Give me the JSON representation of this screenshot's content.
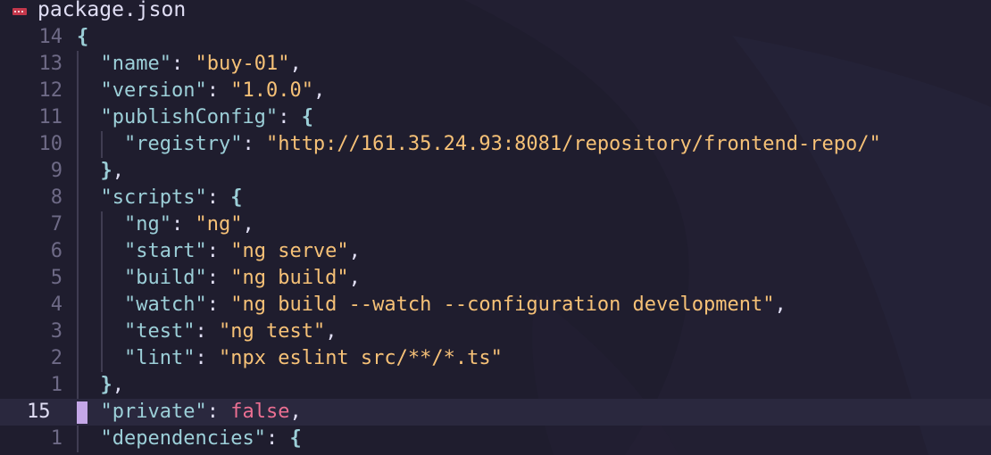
{
  "file": {
    "name": "package.json",
    "icon": "npm-file-icon"
  },
  "colors": {
    "background": "#1f1d2e",
    "key": "#9ccfd8",
    "string": "#f6c177",
    "keyword_false": "#eb6f92",
    "line_number": "#6e6a86",
    "current_line_bg": "#2a283e",
    "mode_marker": "#c4a7e7"
  },
  "lines": [
    {
      "num": "14",
      "indent": 0,
      "tokens": [
        {
          "t": "{",
          "c": "b"
        }
      ]
    },
    {
      "num": "13",
      "indent": 1,
      "tokens": [
        {
          "t": "\"name\"",
          "c": "k"
        },
        {
          "t": ": ",
          "c": "punct"
        },
        {
          "t": "\"buy-01\"",
          "c": "s"
        },
        {
          "t": ",",
          "c": "punct"
        }
      ]
    },
    {
      "num": "12",
      "indent": 1,
      "tokens": [
        {
          "t": "\"version\"",
          "c": "k"
        },
        {
          "t": ": ",
          "c": "punct"
        },
        {
          "t": "\"1.0.0\"",
          "c": "s"
        },
        {
          "t": ",",
          "c": "punct"
        }
      ]
    },
    {
      "num": "11",
      "indent": 1,
      "tokens": [
        {
          "t": "\"publishConfig\"",
          "c": "k"
        },
        {
          "t": ": ",
          "c": "punct"
        },
        {
          "t": "{",
          "c": "b"
        }
      ]
    },
    {
      "num": "10",
      "indent": 2,
      "tokens": [
        {
          "t": "\"registry\"",
          "c": "k"
        },
        {
          "t": ": ",
          "c": "punct"
        },
        {
          "t": "\"http://161.35.24.93:8081/repository/frontend-repo/\"",
          "c": "s"
        }
      ]
    },
    {
      "num": "9",
      "indent": 1,
      "tokens": [
        {
          "t": "}",
          "c": "b"
        },
        {
          "t": ",",
          "c": "punct"
        }
      ]
    },
    {
      "num": "8",
      "indent": 1,
      "tokens": [
        {
          "t": "\"scripts\"",
          "c": "k"
        },
        {
          "t": ": ",
          "c": "punct"
        },
        {
          "t": "{",
          "c": "b"
        }
      ]
    },
    {
      "num": "7",
      "indent": 2,
      "tokens": [
        {
          "t": "\"ng\"",
          "c": "k"
        },
        {
          "t": ": ",
          "c": "punct"
        },
        {
          "t": "\"ng\"",
          "c": "s"
        },
        {
          "t": ",",
          "c": "punct"
        }
      ]
    },
    {
      "num": "6",
      "indent": 2,
      "tokens": [
        {
          "t": "\"start\"",
          "c": "k"
        },
        {
          "t": ": ",
          "c": "punct"
        },
        {
          "t": "\"ng serve\"",
          "c": "s"
        },
        {
          "t": ",",
          "c": "punct"
        }
      ]
    },
    {
      "num": "5",
      "indent": 2,
      "tokens": [
        {
          "t": "\"build\"",
          "c": "k"
        },
        {
          "t": ": ",
          "c": "punct"
        },
        {
          "t": "\"ng build\"",
          "c": "s"
        },
        {
          "t": ",",
          "c": "punct"
        }
      ]
    },
    {
      "num": "4",
      "indent": 2,
      "tokens": [
        {
          "t": "\"watch\"",
          "c": "k"
        },
        {
          "t": ": ",
          "c": "punct"
        },
        {
          "t": "\"ng build --watch --configuration development\"",
          "c": "s"
        },
        {
          "t": ",",
          "c": "punct"
        }
      ]
    },
    {
      "num": "3",
      "indent": 2,
      "tokens": [
        {
          "t": "\"test\"",
          "c": "k"
        },
        {
          "t": ": ",
          "c": "punct"
        },
        {
          "t": "\"ng test\"",
          "c": "s"
        },
        {
          "t": ",",
          "c": "punct"
        }
      ]
    },
    {
      "num": "2",
      "indent": 2,
      "tokens": [
        {
          "t": "\"lint\"",
          "c": "k"
        },
        {
          "t": ": ",
          "c": "punct"
        },
        {
          "t": "\"npx eslint src/**/*.ts\"",
          "c": "s"
        }
      ]
    },
    {
      "num": "1",
      "indent": 1,
      "tokens": [
        {
          "t": "}",
          "c": "b"
        },
        {
          "t": ",",
          "c": "punct"
        }
      ]
    },
    {
      "num": "15",
      "indent": 1,
      "current": true,
      "tokens": [
        {
          "t": "\"private\"",
          "c": "k"
        },
        {
          "t": ": ",
          "c": "punct"
        },
        {
          "t": "false",
          "c": "f"
        },
        {
          "t": ",",
          "c": "punct"
        }
      ]
    },
    {
      "num": "1",
      "indent": 1,
      "tokens": [
        {
          "t": "\"dependencies\"",
          "c": "k"
        },
        {
          "t": ": ",
          "c": "punct"
        },
        {
          "t": "{",
          "c": "b"
        }
      ]
    }
  ]
}
